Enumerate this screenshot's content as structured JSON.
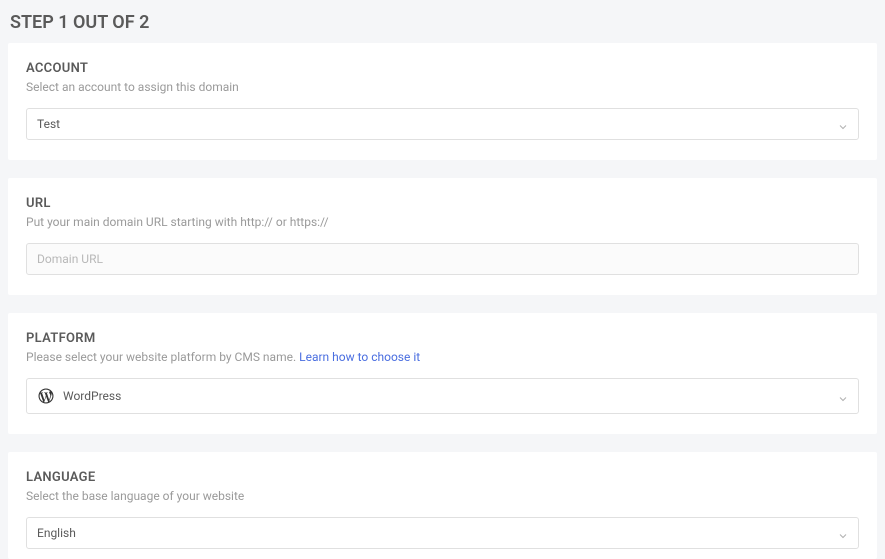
{
  "header": {
    "step_label": "STEP 1 OUT OF 2"
  },
  "account": {
    "title": "ACCOUNT",
    "subtitle": "Select an account to assign this domain",
    "value": "Test"
  },
  "url": {
    "title": "URL",
    "subtitle": "Put your main domain URL starting with http:// or https://",
    "placeholder": "Domain URL"
  },
  "platform": {
    "title": "PLATFORM",
    "subtitle_prefix": "Please select your website platform by CMS name.  ",
    "link_text": "Learn how to choose it",
    "value": "WordPress"
  },
  "language": {
    "title": "LANGUAGE",
    "subtitle": "Select the base language of your website",
    "value": "English"
  }
}
